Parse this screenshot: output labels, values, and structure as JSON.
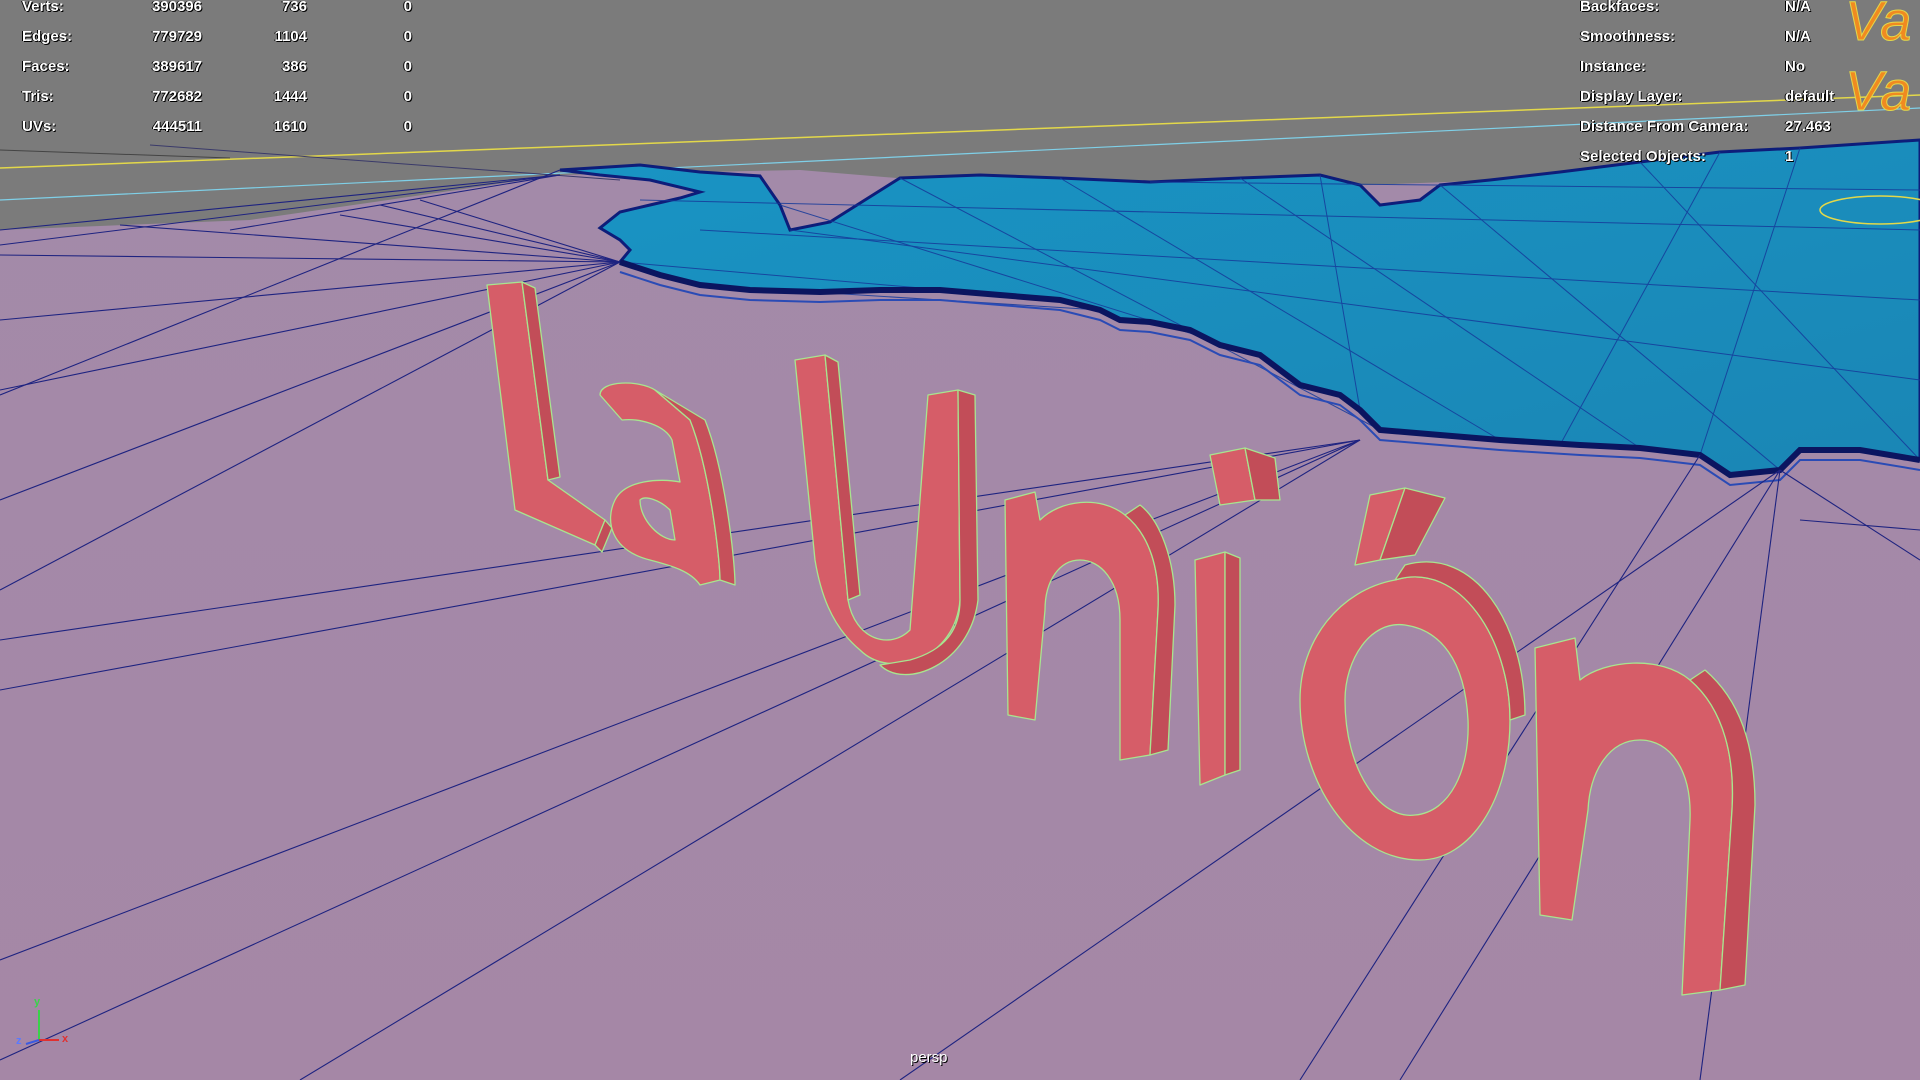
{
  "hud_left": {
    "rows": [
      {
        "label": "Verts:",
        "v1": "390396",
        "v2": "736",
        "v3": "0"
      },
      {
        "label": "Edges:",
        "v1": "779729",
        "v2": "1104",
        "v3": "0"
      },
      {
        "label": "Faces:",
        "v1": "389617",
        "v2": "386",
        "v3": "0"
      },
      {
        "label": "Tris:",
        "v1": "772682",
        "v2": "1444",
        "v3": "0"
      },
      {
        "label": "UVs:",
        "v1": "444511",
        "v2": "1610",
        "v3": "0"
      }
    ]
  },
  "hud_right": {
    "rows": [
      {
        "label": "Backfaces:",
        "value": "N/A"
      },
      {
        "label": "Smoothness:",
        "value": "N/A"
      },
      {
        "label": "Instance:",
        "value": "No"
      },
      {
        "label": "Display Layer:",
        "value": "default"
      },
      {
        "label": "Distance From Camera:",
        "value": "27.463"
      },
      {
        "label": "Selected Objects:",
        "value": "1"
      }
    ]
  },
  "viewport": {
    "camera": "persp",
    "text_object": "La Unión",
    "corner_text": "Va",
    "colors": {
      "ground": "#a688a8",
      "sky": "#7c7c7c",
      "water": "#1a8fbf",
      "letter_face": "#d9606a",
      "letter_side": "#c24f5a",
      "wire": "#1a1f7a",
      "edge_highlight": "#9ae08a"
    }
  },
  "axis": {
    "x": "x",
    "y": "y",
    "z": "z"
  }
}
